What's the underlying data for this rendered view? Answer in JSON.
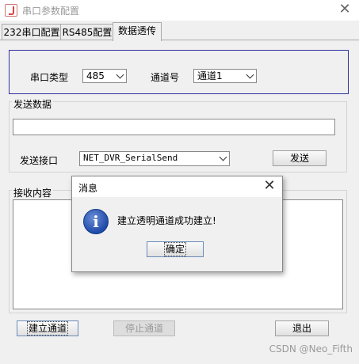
{
  "window": {
    "title": "串口参数配置",
    "close_glyph": "✕"
  },
  "tabs": [
    {
      "label": "232串口配置"
    },
    {
      "label": "RS485配置"
    },
    {
      "label": "数据透传"
    }
  ],
  "serial": {
    "type_label": "串口类型",
    "type_value": "485",
    "channel_label": "通道号",
    "channel_value": "通道1"
  },
  "send": {
    "group_label": "发送数据",
    "input_value": "",
    "interface_label": "发送接口",
    "interface_value": "NET_DVR_SerialSend",
    "send_button": "发送"
  },
  "receive": {
    "group_label": "接收内容"
  },
  "bottom": {
    "establish_button": "建立通道",
    "stop_button": "停止通道",
    "exit_button": "退出"
  },
  "dialog": {
    "title": "消息",
    "close_glyph": "✕",
    "icon_glyph": "i",
    "message": "建立透明通道成功建立!",
    "ok_button": "确定"
  },
  "watermark": "CSDN @Neo_Fifth"
}
